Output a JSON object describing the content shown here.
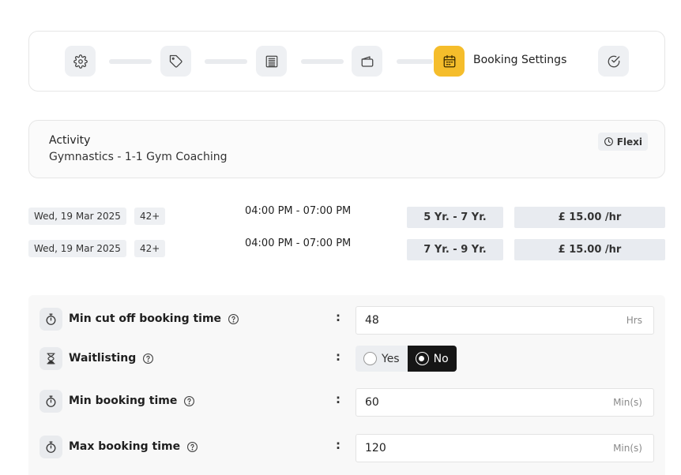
{
  "stepper": {
    "steps": [
      {
        "icon": "gear-icon",
        "active": false
      },
      {
        "icon": "tag-icon",
        "active": false
      },
      {
        "icon": "list-icon",
        "active": false
      },
      {
        "icon": "wallet-icon",
        "active": false
      },
      {
        "icon": "calendar-icon",
        "active": true,
        "label": "Booking Settings"
      },
      {
        "icon": "check-circle-icon",
        "active": false
      }
    ],
    "active_color": "#f5bd2b"
  },
  "activity": {
    "label": "Activity",
    "name": "Gymnastics - 1-1 Gym Coaching",
    "badge": "Flexi"
  },
  "sessions": [
    {
      "date": "Wed, 19 Mar 2025",
      "capacity": "42+",
      "time": "04:00 PM - 07:00 PM",
      "age": "5 Yr. - 7 Yr.",
      "price": "£ 15.00 /hr"
    },
    {
      "date": "Wed, 19 Mar 2025",
      "capacity": "42+",
      "time": "04:00 PM - 07:00 PM",
      "age": "7 Yr. - 9 Yr.",
      "price": "£ 15.00 /hr"
    }
  ],
  "settings": {
    "colon": ":",
    "min_cutoff": {
      "label": "Min cut off booking time",
      "value": "48",
      "unit": "Hrs"
    },
    "waitlisting": {
      "label": "Waitlisting",
      "options": [
        "Yes",
        "No"
      ],
      "selected": "No"
    },
    "min_booking": {
      "label": "Min booking time",
      "value": "60",
      "unit": "Min(s)"
    },
    "max_booking": {
      "label": "Max booking time",
      "value": "120",
      "unit": "Min(s)"
    }
  }
}
